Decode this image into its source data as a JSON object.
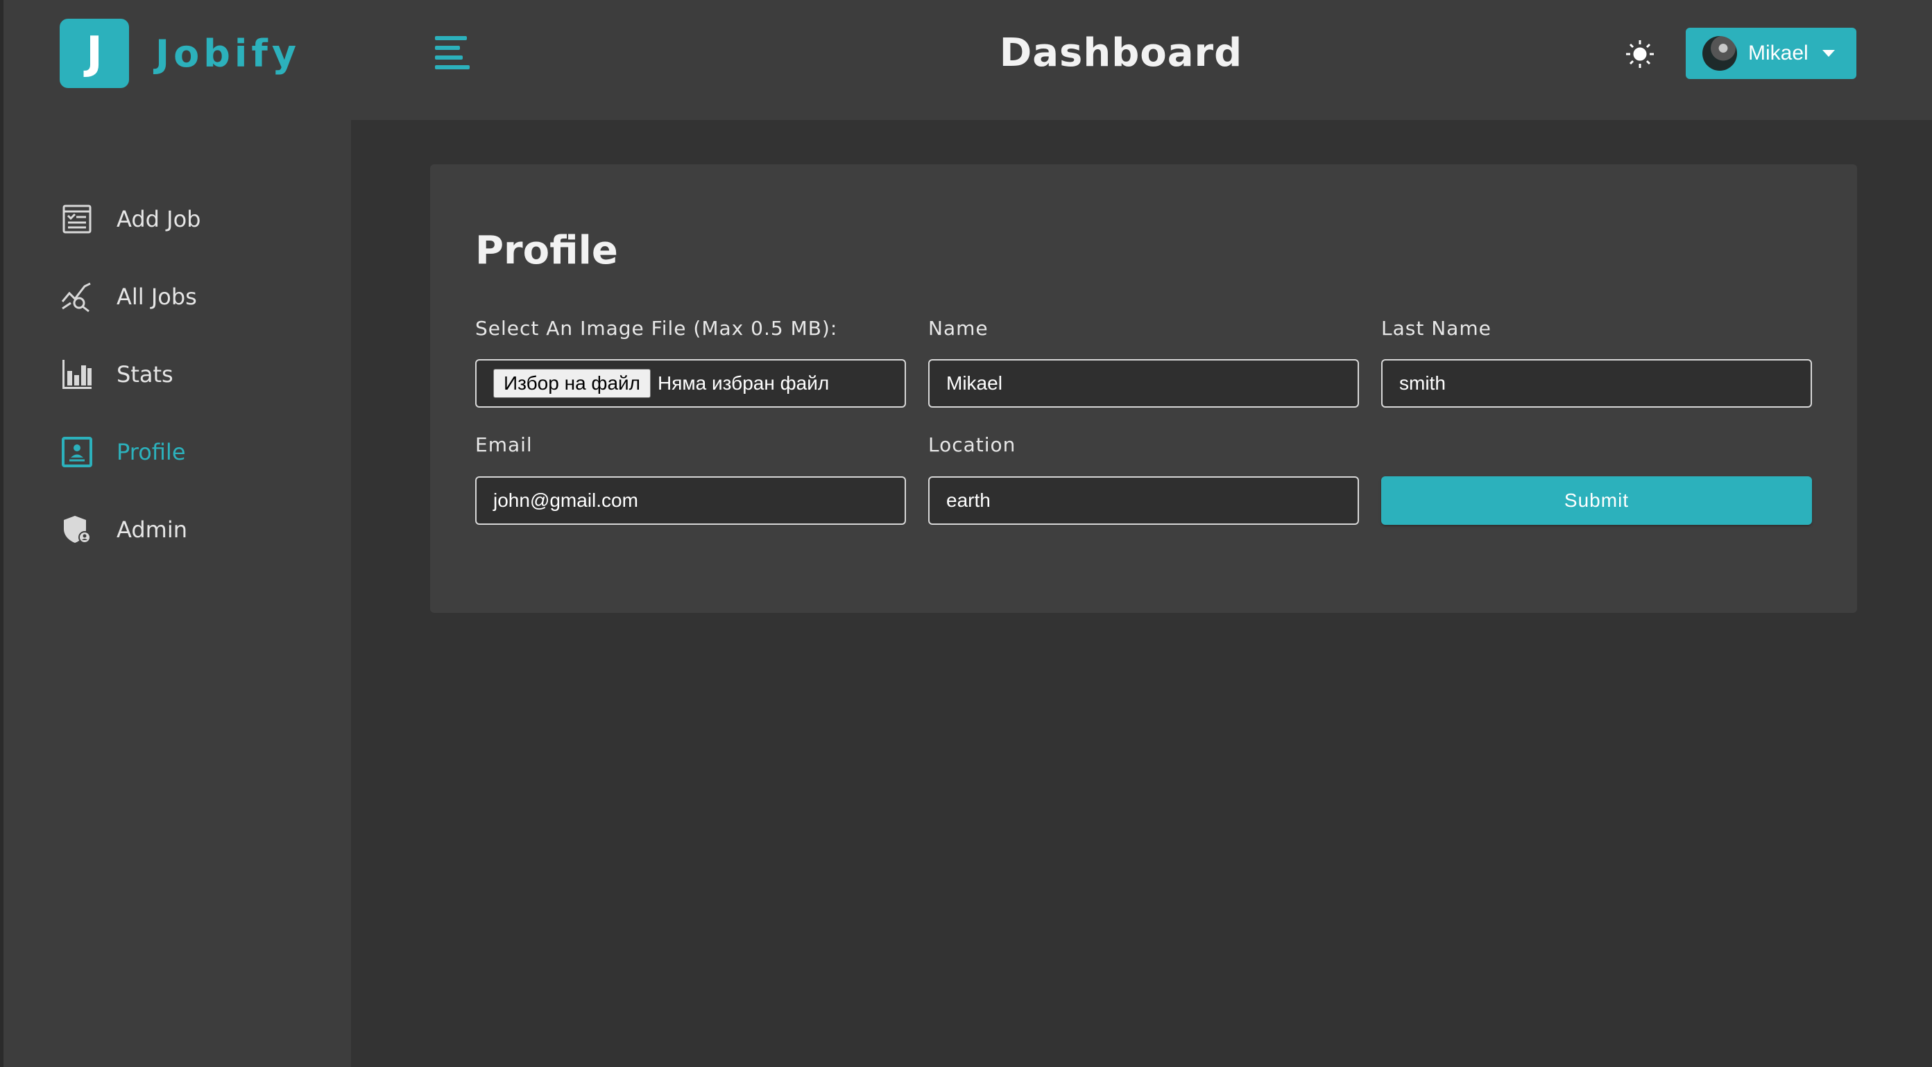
{
  "brand": {
    "logo_letter": "J",
    "name": "Jobify",
    "accent_color": "#2cb1bc"
  },
  "sidebar": {
    "items": [
      {
        "label": "Add Job",
        "icon": "add-job-icon",
        "active": false
      },
      {
        "label": "All Jobs",
        "icon": "all-jobs-icon",
        "active": false
      },
      {
        "label": "Stats",
        "icon": "stats-icon",
        "active": false
      },
      {
        "label": "Profile",
        "icon": "profile-icon",
        "active": true
      },
      {
        "label": "Admin",
        "icon": "admin-icon",
        "active": false
      }
    ]
  },
  "header": {
    "title": "Dashboard",
    "theme_icon": "sun-icon",
    "user": {
      "name": "Mikael",
      "caret_icon": "caret-down-icon"
    }
  },
  "profile_form": {
    "title": "Profile",
    "image": {
      "label": "Select An Image File (Max 0.5 MB):",
      "button_label": "Избор на файл",
      "status": "Няма избран файл"
    },
    "name": {
      "label": "Name",
      "value": "Mikael"
    },
    "last_name": {
      "label": "Last Name",
      "value": "smith"
    },
    "email": {
      "label": "Email",
      "value": "john@gmail.com"
    },
    "location": {
      "label": "Location",
      "value": "earth"
    },
    "submit_label": "Submit"
  }
}
